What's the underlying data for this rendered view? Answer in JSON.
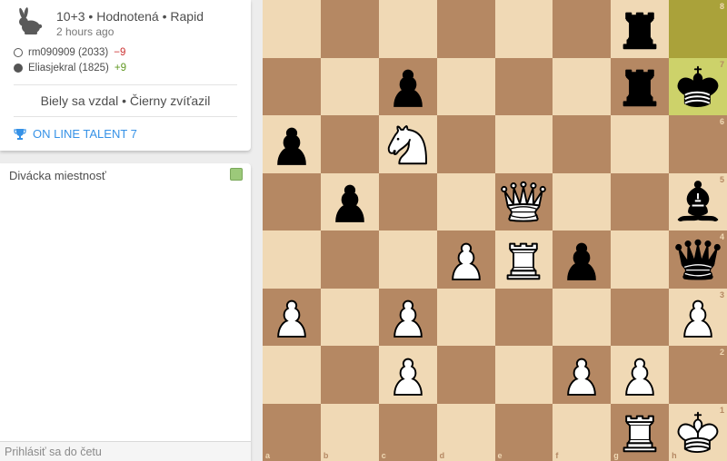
{
  "game": {
    "speed_icon": "rabbit-icon",
    "title": "10+3 • Hodnotená • Rapid",
    "time_ago": "2 hours ago",
    "players": [
      {
        "color": "white",
        "name": "rm090909 (2033)",
        "rating_diff": "−9"
      },
      {
        "color": "black",
        "name": "Eliasjekral (1825)",
        "rating_diff": "+9"
      }
    ],
    "result": "Biely sa vzdal • Čierny zvíťazil",
    "tournament_icon": "trophy-icon",
    "tournament": "ON LINE TALENT 7"
  },
  "chat": {
    "header": "Divácka miestnosť",
    "input_placeholder": "Prihlásiť sa do četu"
  },
  "board": {
    "orientation": "white",
    "files": [
      "a",
      "b",
      "c",
      "d",
      "e",
      "f",
      "g",
      "h"
    ],
    "ranks": [
      "8",
      "7",
      "6",
      "5",
      "4",
      "3",
      "2",
      "1"
    ],
    "last_move": [
      "h8",
      "h7"
    ],
    "pieces": {
      "g8": "bR",
      "c7": "bP",
      "g7": "bR",
      "h7": "bK",
      "a6": "bP",
      "c6": "wN",
      "b5": "bP",
      "e5": "wQ",
      "h5": "bB",
      "d4": "wP",
      "e4": "wR",
      "f4": "bP",
      "h4": "bQ",
      "a3": "wP",
      "c3": "wP",
      "h3": "wP",
      "c2": "wP",
      "f2": "wP",
      "g2": "wP",
      "g1": "wR",
      "h1": "wK"
    }
  },
  "colors": {
    "light_square": "#f0d9b5",
    "dark_square": "#b58863",
    "last_move_dark": "#aaa23a",
    "last_move_light": "#cdd26a",
    "link": "#3692e7",
    "negative": "#cc3333",
    "positive": "#629924"
  }
}
